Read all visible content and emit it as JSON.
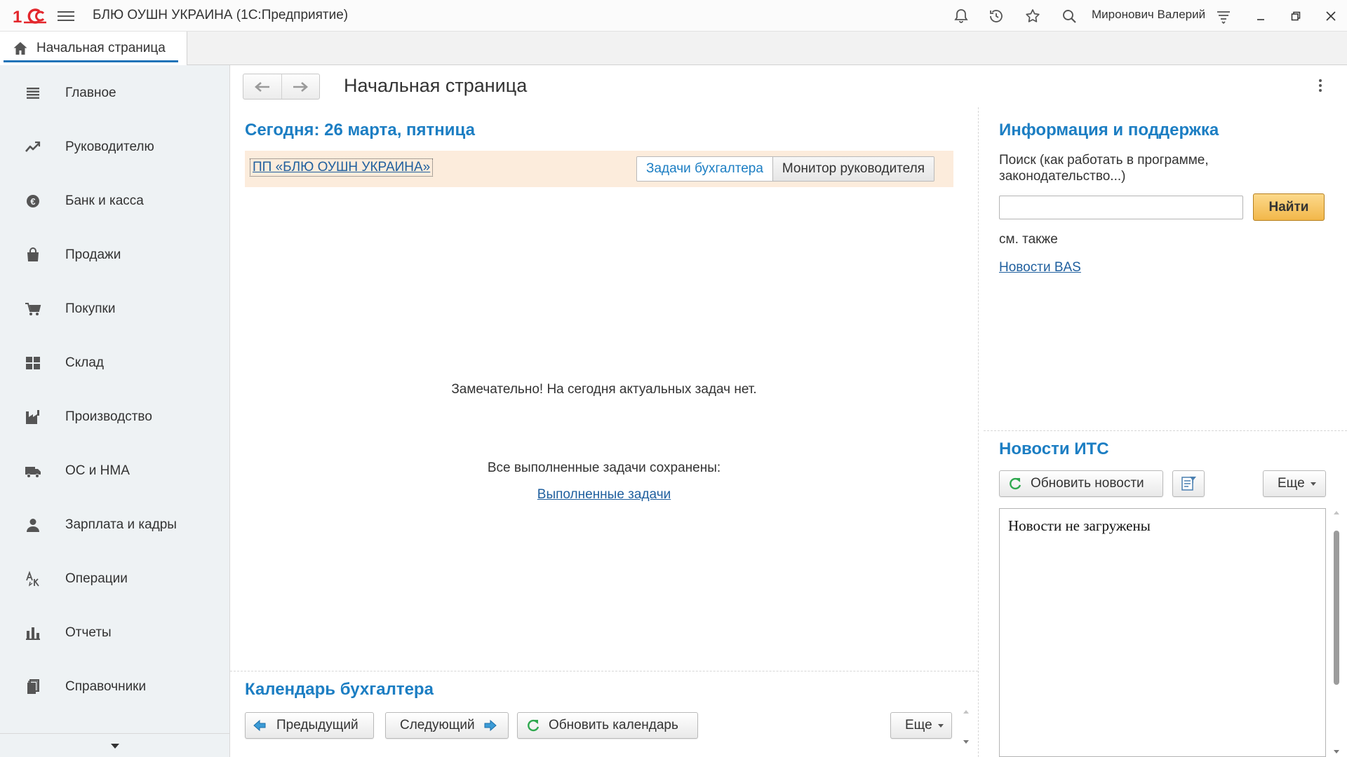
{
  "app": {
    "title": "БЛЮ ОУШН УКРАИНА  (1С:Предприятие)",
    "user": "Миронович Валерий",
    "colors": {
      "accent": "#1c7ec3",
      "tab_underline": "#1c73b8",
      "logo_red": "#e3262c",
      "find_button": "#f2b74a",
      "org_strip": "#fcecdc"
    }
  },
  "titlebar": {
    "icons": [
      "notifications-bell-icon",
      "history-clock-icon",
      "favorites-star-icon",
      "search-icon",
      "settings-lines-icon"
    ],
    "window_buttons": [
      "minimize-icon",
      "restore-icon",
      "close-icon"
    ]
  },
  "tabs": [
    {
      "label": "Начальная страница",
      "icon": "home-icon"
    }
  ],
  "sidebar": {
    "items": [
      {
        "label": "Главное",
        "icon": "list-icon"
      },
      {
        "label": "Руководителю",
        "icon": "trend-chart-icon"
      },
      {
        "label": "Банк и касса",
        "icon": "coin-icon"
      },
      {
        "label": "Продажи",
        "icon": "shopping-bag-icon"
      },
      {
        "label": "Покупки",
        "icon": "cart-icon"
      },
      {
        "label": "Склад",
        "icon": "warehouse-grid-icon"
      },
      {
        "label": "Производство",
        "icon": "factory-icon"
      },
      {
        "label": "ОС и НМА",
        "icon": "truck-icon"
      },
      {
        "label": "Зарплата и кадры",
        "icon": "person-icon"
      },
      {
        "label": "Операции",
        "icon": "operations-icon"
      },
      {
        "label": "Отчеты",
        "icon": "bar-chart-icon"
      },
      {
        "label": "Справочники",
        "icon": "books-icon"
      }
    ]
  },
  "header": {
    "page_title": "Начальная страница"
  },
  "tasks": {
    "today_title": "Сегодня: 26 марта, пятница",
    "organization": "ПП «БЛЮ ОУШН УКРАИНА»",
    "mode_options": [
      "Задачи бухгалтера",
      "Монитор руководителя"
    ],
    "selected_mode": "Задачи бухгалтера",
    "empty_message": "Замечательно! На сегодня актуальных задач нет.",
    "saved_message": "Все выполненные задачи сохранены:",
    "done_link": "Выполненные задачи"
  },
  "calendar": {
    "title": "Календарь бухгалтера",
    "prev_label": "Предыдущий",
    "next_label": "Следующий",
    "refresh_label": "Обновить календарь",
    "more_label": "Еще"
  },
  "info": {
    "title": "Информация и поддержка",
    "search_label": "Поиск (как работать в программе, законодательство...)",
    "search_value": "",
    "find_label": "Найти",
    "see_also": "см. также",
    "news_link": "Новости BAS"
  },
  "news": {
    "title": "Новости ИТС",
    "refresh_label": "Обновить новости",
    "more_label": "Еще",
    "content": "Новости не загружены"
  }
}
